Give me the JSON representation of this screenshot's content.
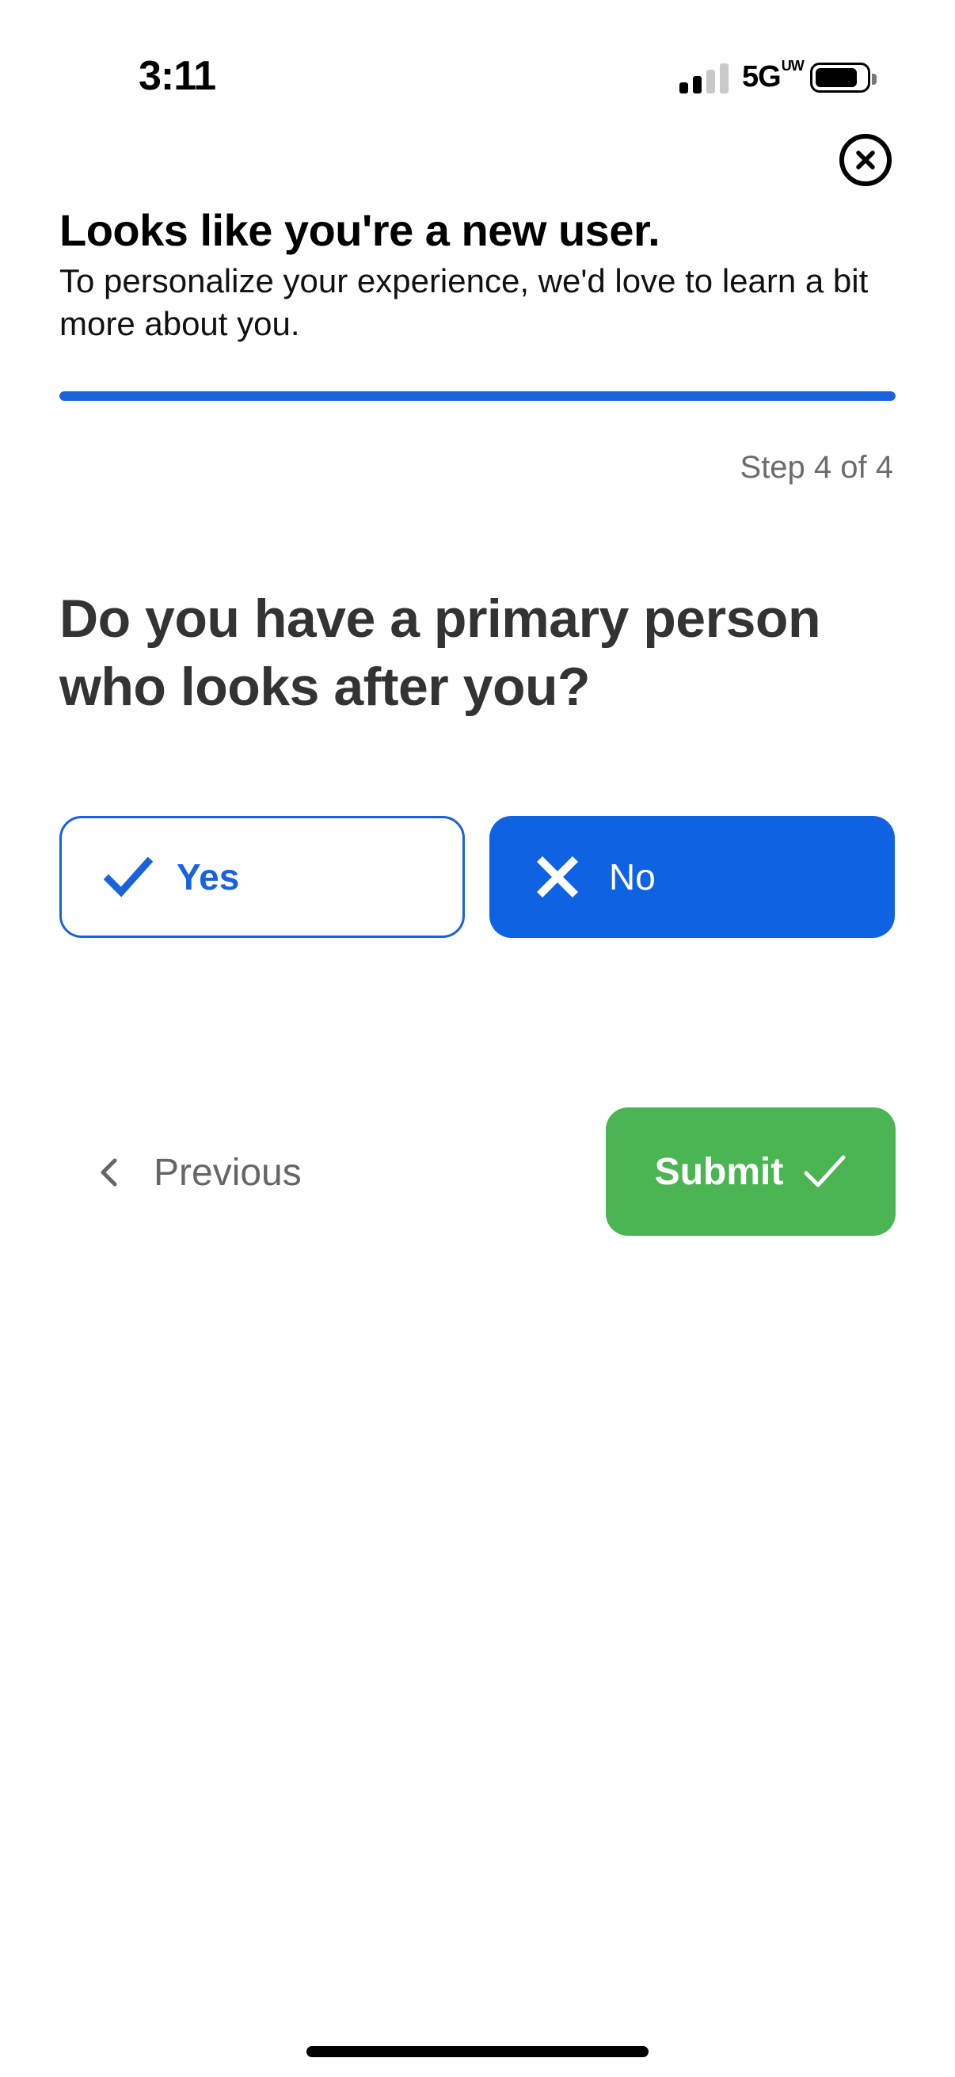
{
  "status_bar": {
    "time": "3:11",
    "network": "5G",
    "network_badge": "UW",
    "signal_bars_active": 2,
    "signal_bars_total": 4
  },
  "header": {
    "title": "Looks like you're a new user.",
    "subtitle": "To personalize your experience, we'd love to learn a bit more about you."
  },
  "progress": {
    "current_step": 4,
    "total_steps": 4,
    "fraction": 1.0,
    "label": "Step 4 of 4"
  },
  "question": {
    "text": "Do you have a primary person who looks after you?"
  },
  "options": {
    "yes_label": "Yes",
    "no_label": "No",
    "selected": "No"
  },
  "navigation": {
    "previous_label": "Previous",
    "submit_label": "Submit"
  },
  "colors": {
    "primary": "#0f62e2",
    "success": "#4cb553",
    "muted_text": "#666666",
    "question_text": "#333333"
  },
  "icons": {
    "close": "close-circle-icon",
    "yes": "checkmark-icon",
    "no": "x-icon",
    "previous": "chevron-left-icon",
    "submit": "checkmark-icon"
  }
}
